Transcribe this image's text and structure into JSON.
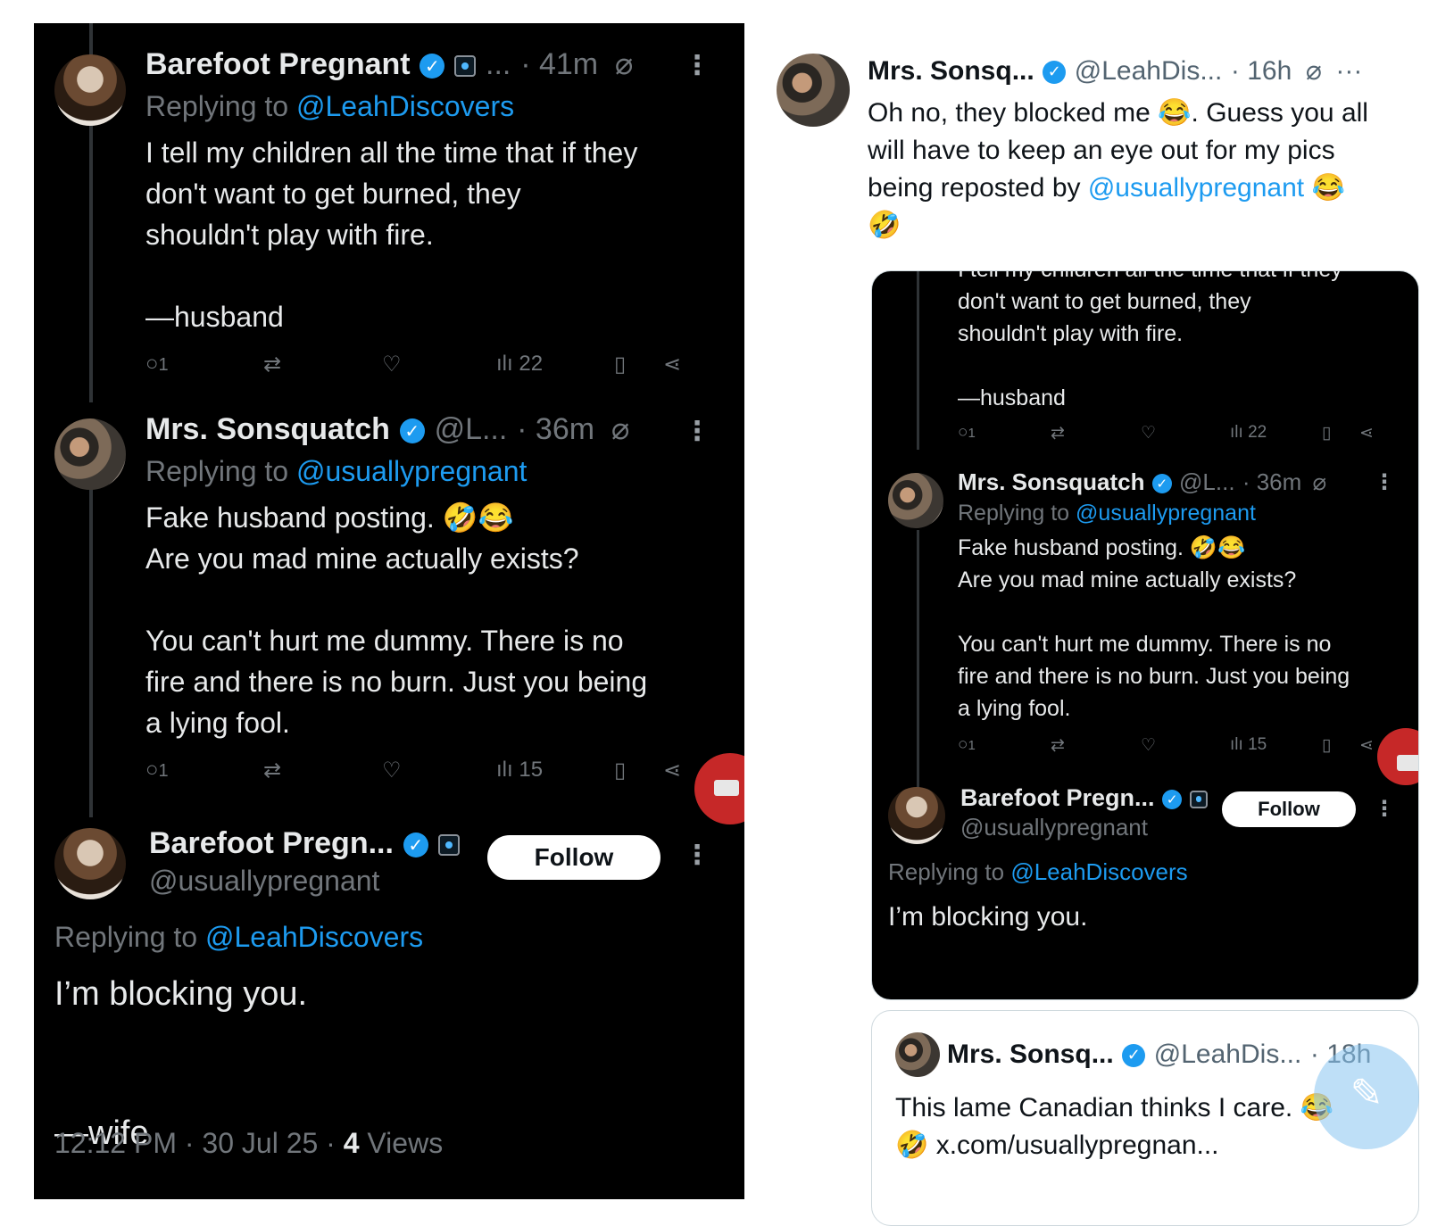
{
  "left": {
    "t1": {
      "name": "Barefoot Pregnant",
      "ellipsis": "...",
      "time": "· 41m",
      "replying_label": "Replying to",
      "replying_handle": "@LeahDiscovers",
      "text": "I tell my children all the time that if they\ndon't want to get burned, they\nshouldn't play with fire.\n\n—husband",
      "replies": "1",
      "views": "22"
    },
    "t2": {
      "name": "Mrs. Sonsquatch",
      "handle": "@L...",
      "time": "· 36m",
      "replying_label": "Replying to",
      "replying_handle": "@usuallypregnant",
      "text": "Fake husband posting. 🤣😂\nAre you mad mine actually exists?\n\nYou can't hurt me dummy. There is no\nfire and there is no burn. Just you being\na lying fool.",
      "replies": "1",
      "views": "15"
    },
    "t3": {
      "name": "Barefoot Pregn...",
      "handle": "@usuallypregnant",
      "follow_label": "Follow",
      "replying_label": "Replying to",
      "replying_handle": "@LeahDiscovers",
      "text": "I’m blocking you.\n\n\n—wife",
      "timestamp": "12:12 PM · 30 Jul 25 · ",
      "views_count": "4",
      "views_label": " Views"
    }
  },
  "right": {
    "post": {
      "name": "Mrs. Sonsq...",
      "handle": "@LeahDis...",
      "time": "· 16h",
      "text_a": "Oh no, they blocked me 😂. Guess you all\nwill have to keep an eye out for my pics\nbeing reposted by ",
      "mention": "@usuallypregnant",
      "text_b": " 😂\n🤣"
    },
    "embed": {
      "t1_text": "I tell my children all the time that if they\ndon't want to get burned, they\nshouldn't play with fire.\n\n—husband",
      "t1_replies": "1",
      "t1_views": "22",
      "t2_name": "Mrs. Sonsquatch",
      "t2_handle": "@L...",
      "t2_time": "· 36m",
      "t2_replying_label": "Replying to",
      "t2_replying_handle": "@usuallypregnant",
      "t2_text": "Fake husband posting. 🤣😂\nAre you mad mine actually exists?\n\nYou can't hurt me dummy. There is no\nfire and there is no burn. Just you being\na lying fool.",
      "t2_replies": "1",
      "t2_views": "15",
      "t3_name": "Barefoot Pregn...",
      "t3_handle": "@usuallypregnant",
      "t3_follow": "Follow",
      "t3_replying_label": "Replying to",
      "t3_replying_handle": "@LeahDiscovers",
      "t3_text": "I’m blocking you."
    },
    "quote": {
      "name": "Mrs. Sonsq...",
      "handle": "@LeahDis...",
      "time": "· 18h",
      "text": "This lame Canadian thinks I care. 😂\n🤣 x.com/usuallypregnan..."
    }
  },
  "icons": {
    "verified": "verified-badge-icon",
    "affiliate": "affiliate-badge-icon",
    "no_entry": "no-entry-icon",
    "more": "more-options-icon",
    "reply": "reply-icon",
    "retweet": "retweet-icon",
    "like": "like-icon",
    "views": "views-icon",
    "bookmark": "bookmark-icon",
    "share": "share-icon",
    "compose": "compose-icon"
  },
  "colors": {
    "accent": "#1d9bf0",
    "dark_bg": "#000000",
    "muted": "#71767b"
  }
}
